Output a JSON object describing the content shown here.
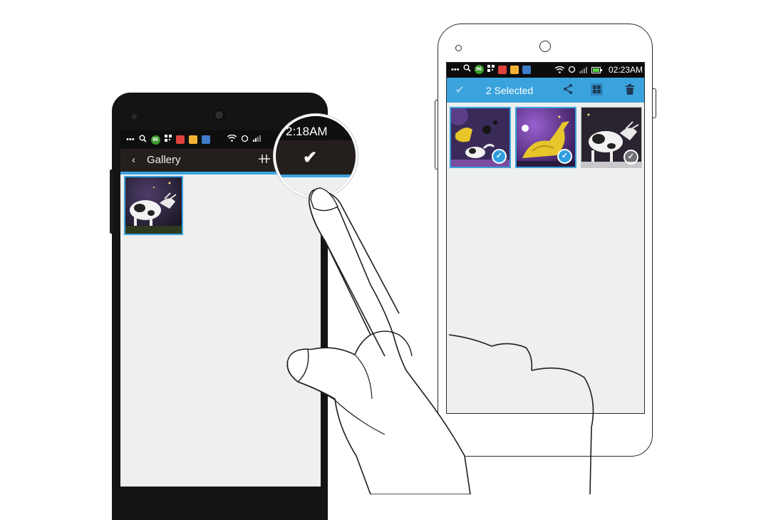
{
  "left_phone": {
    "statusbar": {
      "dots": "•••",
      "badge": "96",
      "time": "2:18AM"
    },
    "actionbar": {
      "back_icon": "chevron-left-icon",
      "title": "Gallery",
      "filter_icon": "filter-icon",
      "confirm_icon": "checkmark-icon"
    },
    "thumbnails": [
      {
        "alt": "cow-with-eye-patch",
        "selected": true
      }
    ]
  },
  "right_phone": {
    "statusbar": {
      "dots": "•••",
      "badge": "96",
      "time": "02:23AM"
    },
    "actionbar": {
      "done_icon": "checkmark-icon",
      "title": "2 Selected",
      "share_icon": "share-icon",
      "grid_icon": "grid-icon",
      "trash_icon": "trash-icon"
    },
    "thumbnails": [
      {
        "alt": "cow-and-duck-at-night",
        "selected": true
      },
      {
        "alt": "yellow-duck-night-sky",
        "selected": true
      },
      {
        "alt": "cow-with-eye-patch",
        "selected": false
      }
    ]
  },
  "colors": {
    "accent": "#3aa3dd",
    "dark_actionbar": "#241f1d",
    "screen_bg": "#eef0ef"
  }
}
